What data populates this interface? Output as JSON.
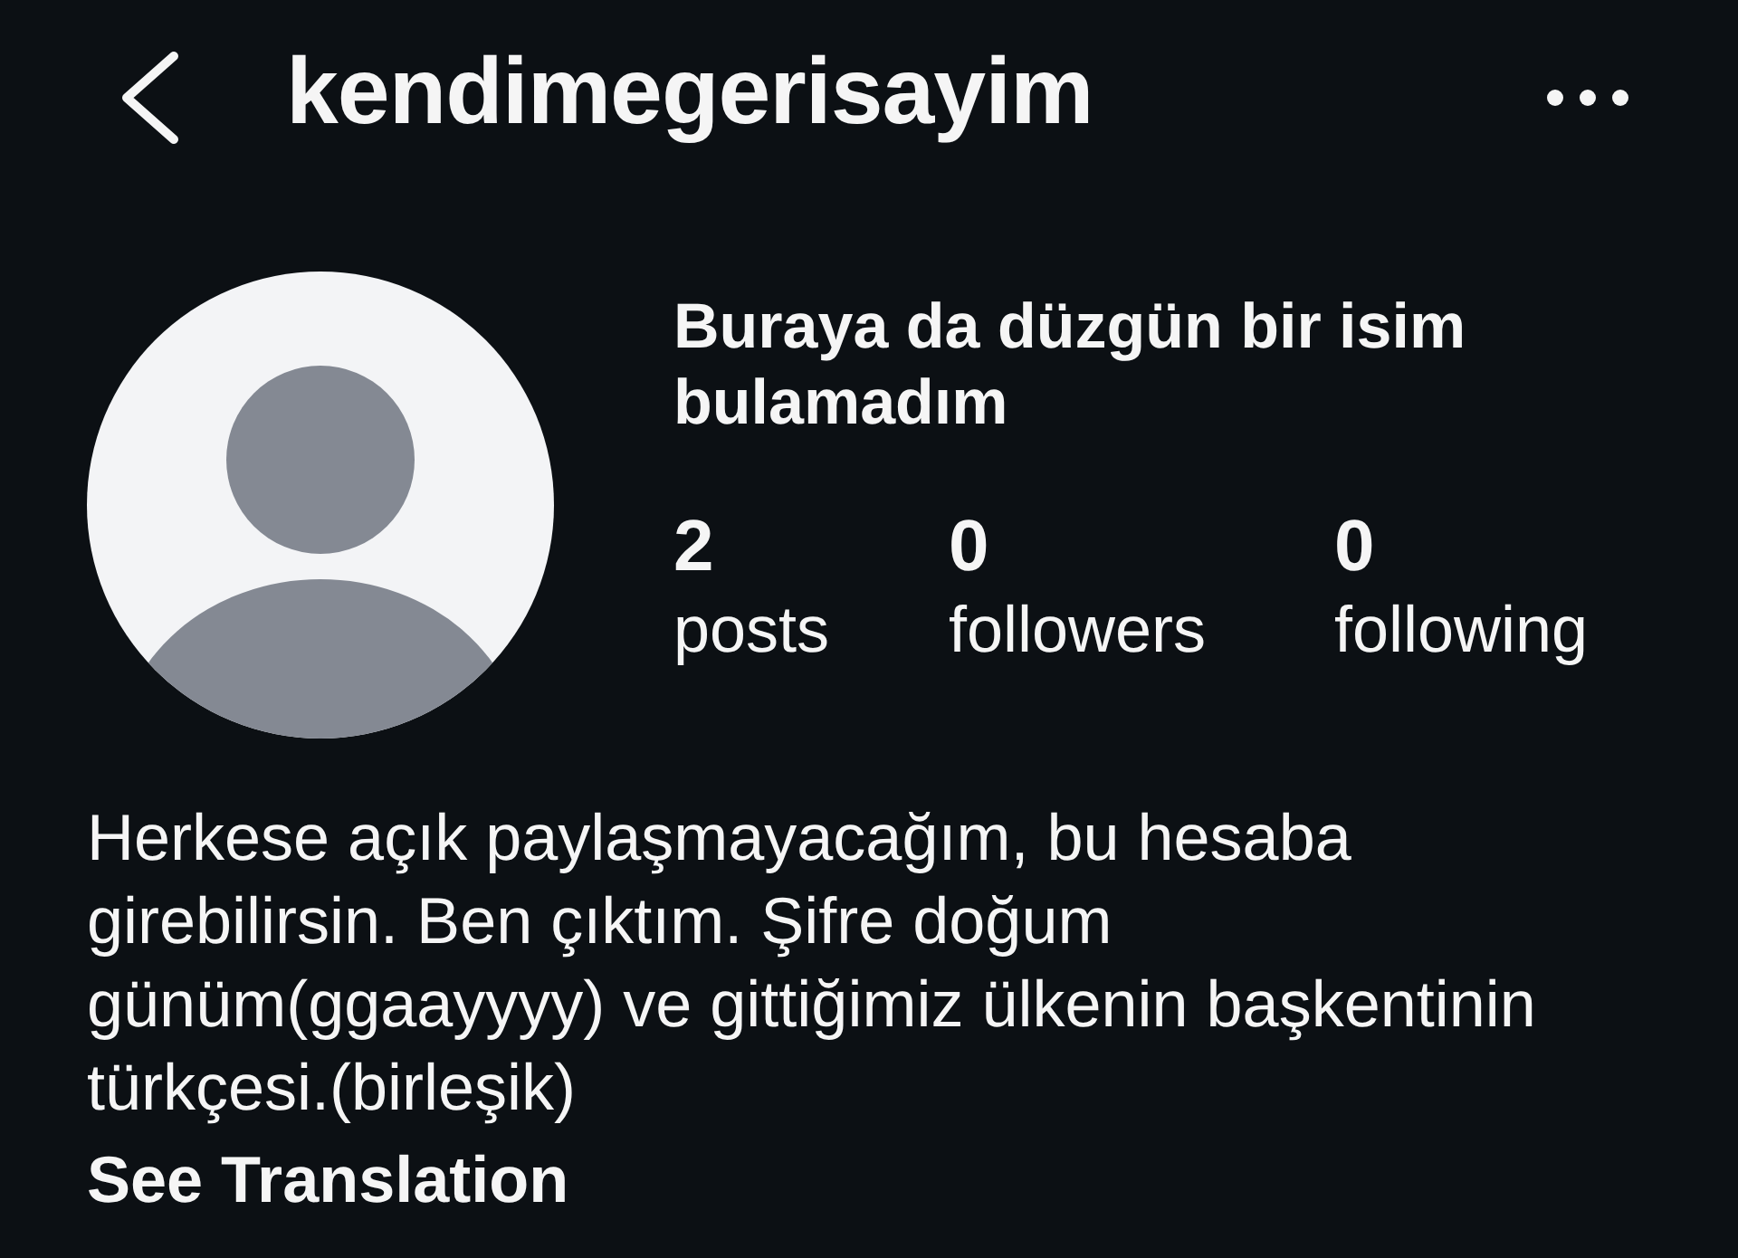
{
  "header": {
    "title": "kendimegerisayim"
  },
  "profile": {
    "name": "Buraya da düzgün bir isim bulamadım",
    "stats": [
      {
        "value": "2",
        "label": "posts"
      },
      {
        "value": "0",
        "label": "followers"
      },
      {
        "value": "0",
        "label": "following"
      }
    ]
  },
  "bio": {
    "text": "Herkese açık paylaşmayacağım, bu hesaba girebilirsin. Ben çıktım. Şifre doğum günüm(ggaayyyy) ve gittiğimiz ülkenin başkentinin türkçesi.(birleşik)",
    "link": "See Translation"
  }
}
